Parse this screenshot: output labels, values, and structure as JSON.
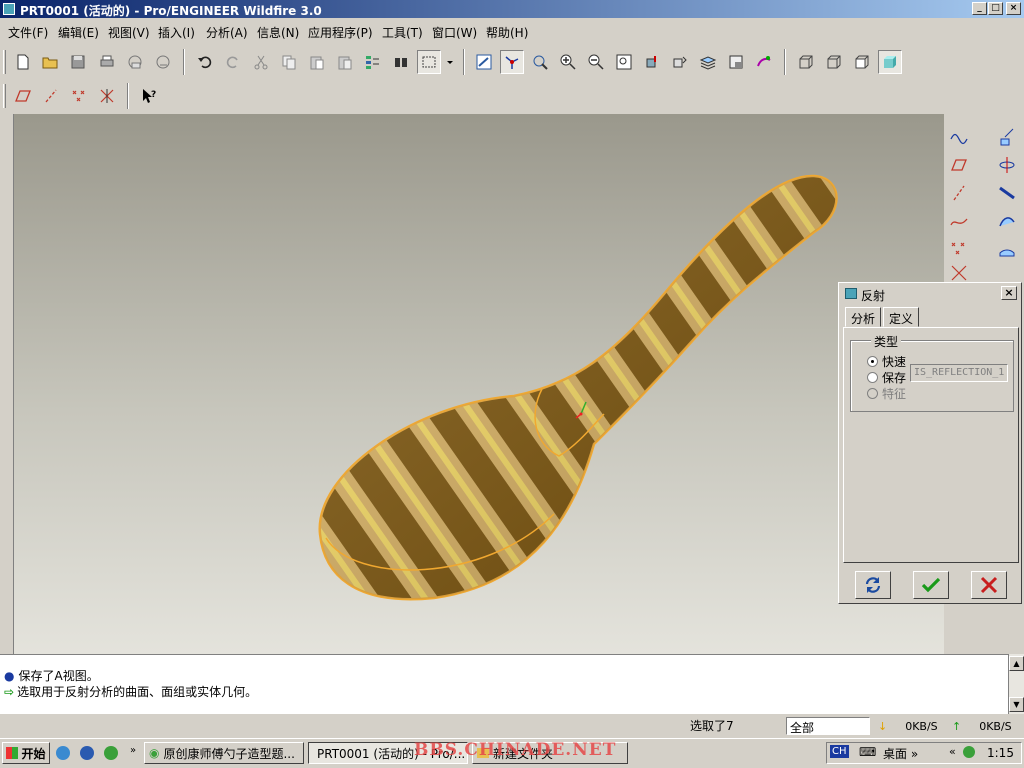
{
  "window": {
    "title": "PRT0001 (活动的) - Pro/ENGINEER Wildfire 3.0",
    "controls": {
      "minimize": "_",
      "maximize": "□",
      "close": "×"
    }
  },
  "menu": [
    "文件(F)",
    "编辑(E)",
    "视图(V)",
    "插入(I)",
    "分析(A)",
    "信息(N)",
    "应用程序(P)",
    "工具(T)",
    "窗口(W)",
    "帮助(H)"
  ],
  "dialog": {
    "title": "反射",
    "close": "×",
    "tabs": [
      "分析",
      "定义"
    ],
    "group_label": "类型",
    "options": [
      "快速",
      "保存",
      "特征"
    ],
    "selected_option": "快速",
    "name_value": "IS_REFLECTION_1"
  },
  "messages": [
    "保存了A视图。",
    "选取用于反射分析的曲面、面组或实体几何。"
  ],
  "status": {
    "selection": "选取了7",
    "filter": "全部",
    "download_speed": "0KB/S",
    "upload_speed": "0KB/S"
  },
  "taskbar": {
    "start": "开始",
    "tasks": [
      "原创康师傅勺子造型题...",
      "PRT0001 (活动的) - Pro/...",
      "新建文件夹"
    ],
    "ime": "CH",
    "desktop": "桌面",
    "clock": "1:15",
    "watermark": "BBS.CHINADE.NET"
  },
  "colors": {
    "title_bar": "#0a246a",
    "chrome": "#d4d0c8",
    "model_highlight": "#f0a830",
    "ok_green": "#1a9a1a",
    "cancel_red": "#c81e1e"
  },
  "icons": {
    "file_toolbar": [
      "new-file-icon",
      "open-folder-icon",
      "save-icon",
      "print-icon",
      "email-icon",
      "email-link-icon",
      "undo-icon",
      "redo-icon",
      "cut-icon",
      "copy-icon",
      "paste-icon",
      "paste-special-icon",
      "regenerate-icon",
      "find-icon",
      "select-box-icon"
    ],
    "view_toolbar": [
      "repaint-icon",
      "spin-center-icon",
      "orient-icon",
      "zoom-in-icon",
      "zoom-out-icon",
      "refit-icon",
      "reorient-icon",
      "saved-views-icon",
      "layers-icon",
      "view-manager-icon",
      "appearance-icon",
      "wireframe-icon",
      "hidden-line-icon",
      "no-hidden-icon",
      "shading-icon"
    ],
    "datum_toolbar": [
      "datum-planes-icon",
      "datum-axes-icon",
      "datum-points-icon",
      "coordinate-systems-icon",
      "context-help-icon"
    ],
    "right_col1": [
      "sketch-curve-icon",
      "datum-plane-icon",
      "datum-axis-icon",
      "datum-curve-icon",
      "datum-point-icon",
      "datum-csys-icon"
    ],
    "right_col2": [
      "extrude-icon",
      "revolve-icon",
      "sweep-icon",
      "blend-icon",
      "surface-icon"
    ]
  }
}
